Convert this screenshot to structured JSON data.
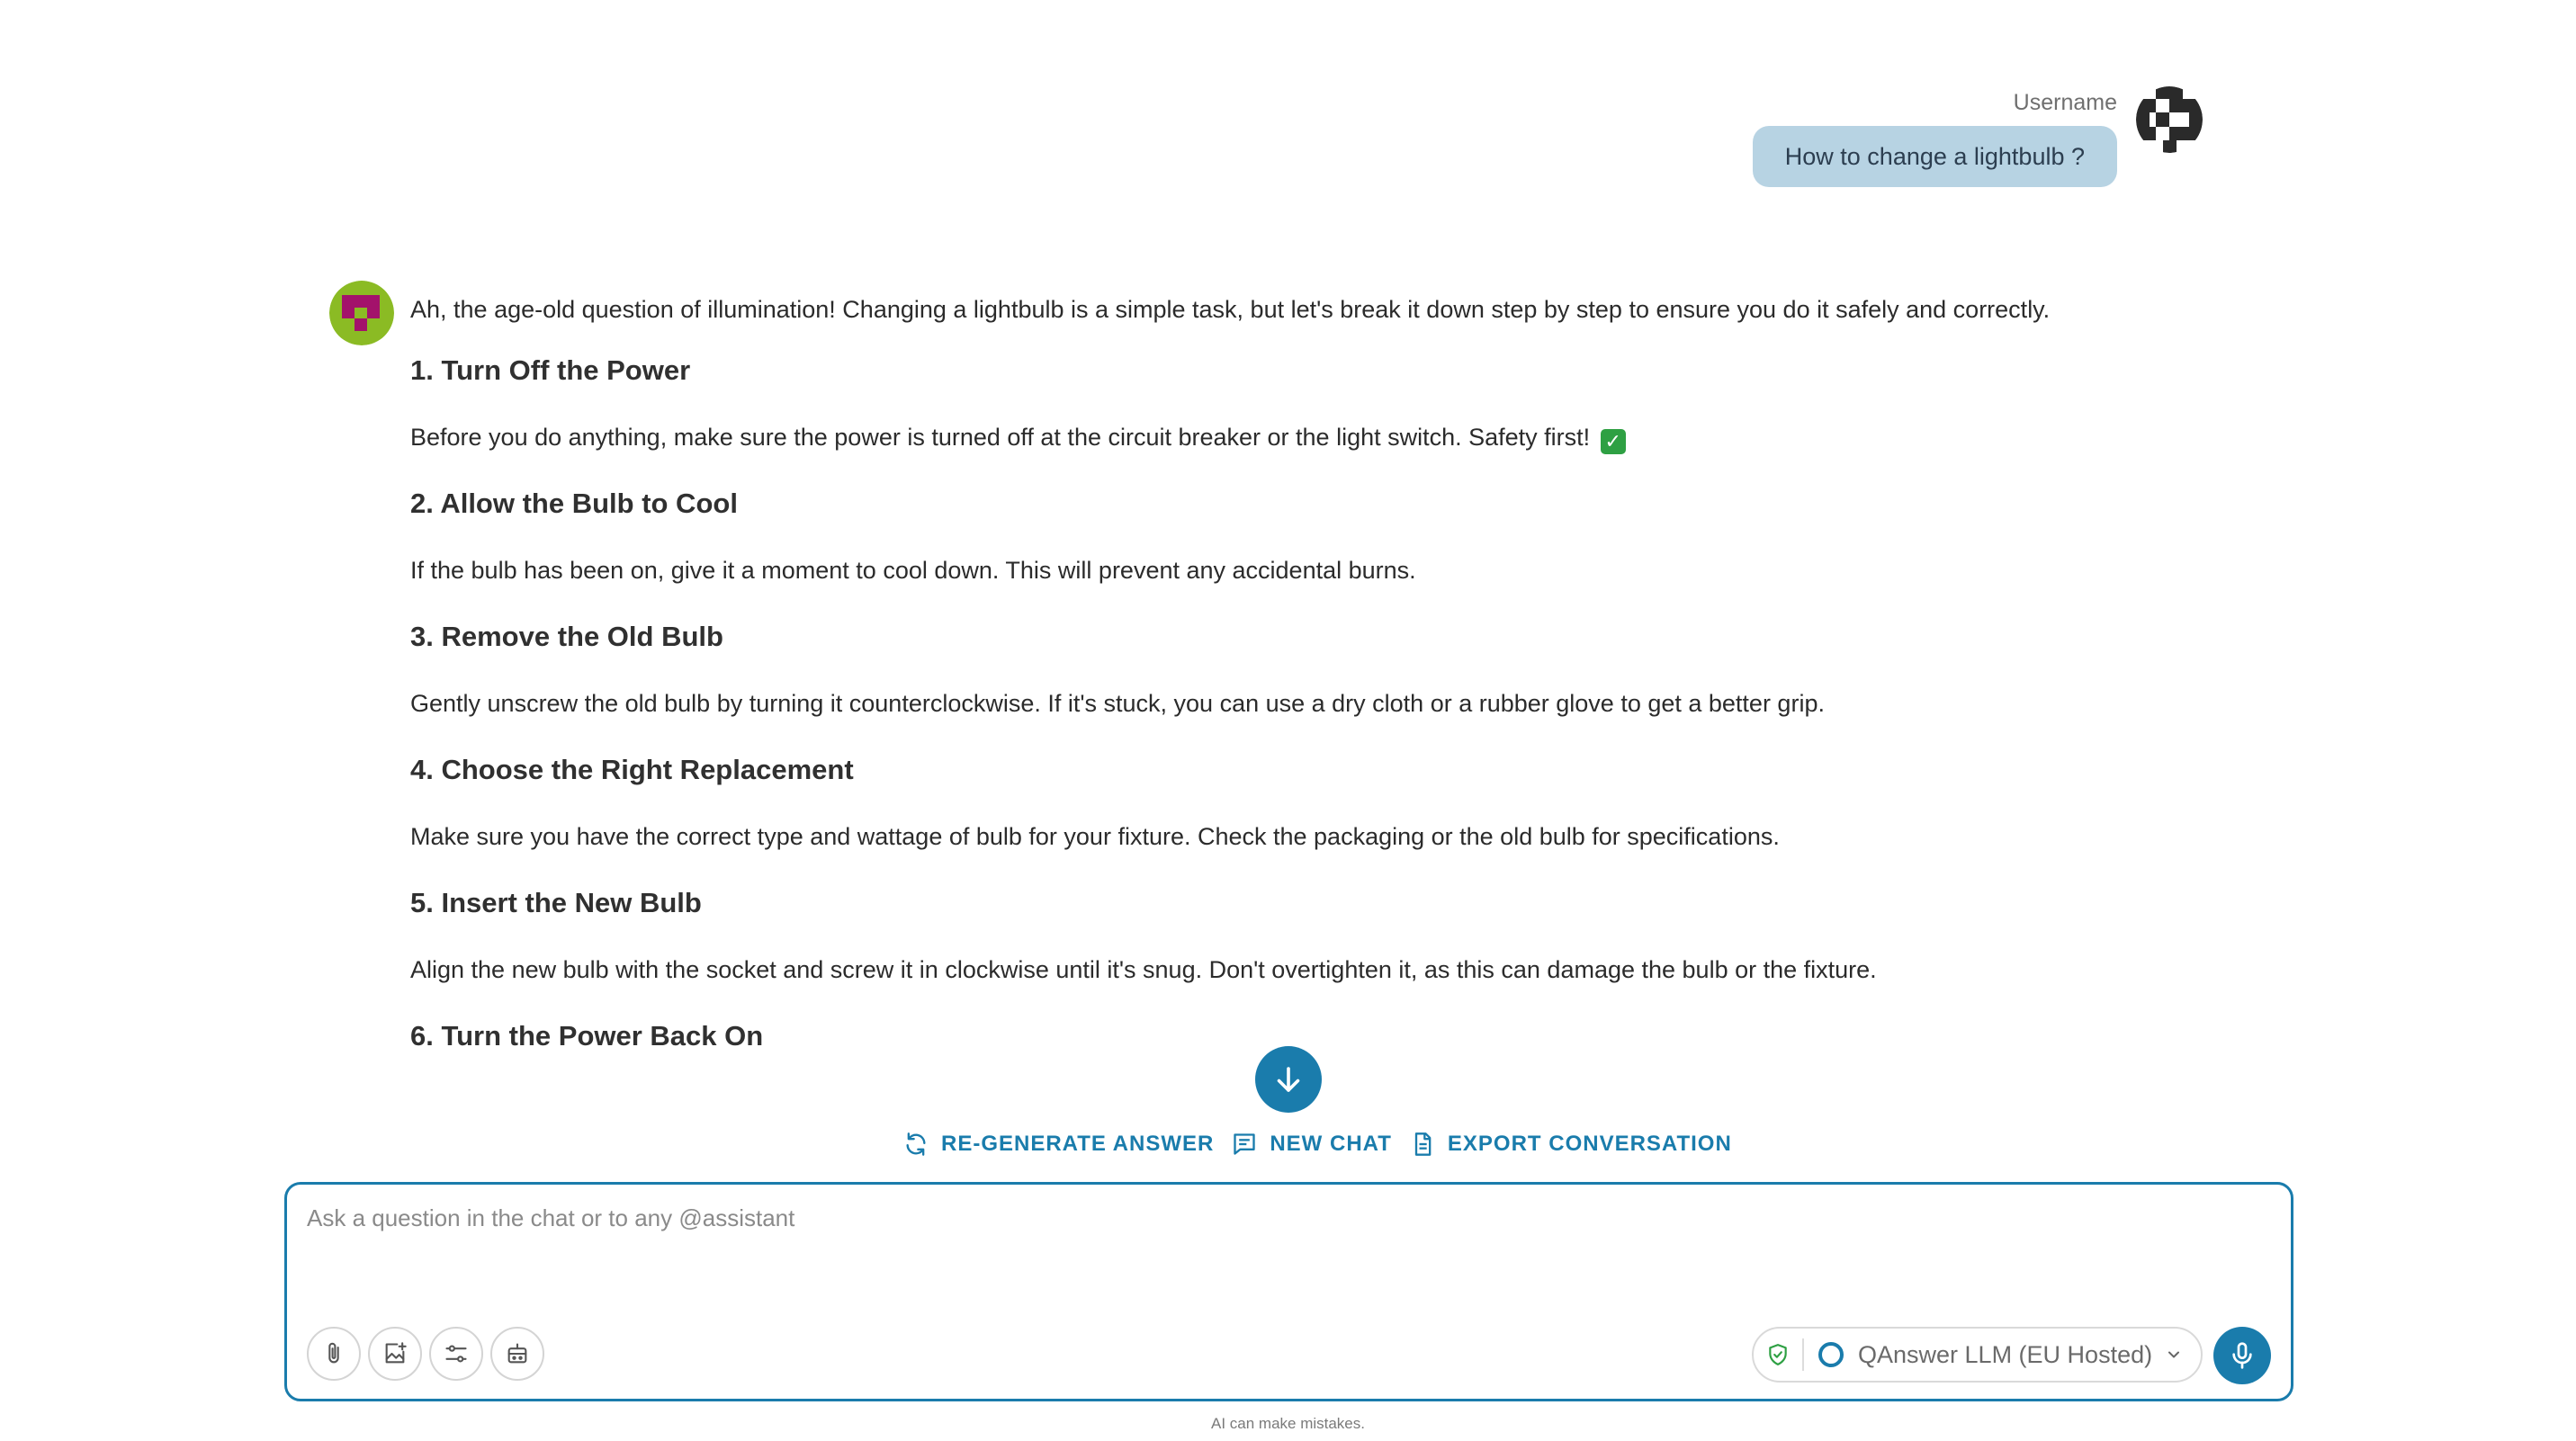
{
  "user": {
    "name": "Username",
    "message": "How to change a lightbulb ?"
  },
  "answer": {
    "intro": "Ah, the age-old question of illumination! Changing a lightbulb is a simple task, but let's break it down step by step to ensure you do it safely and correctly.",
    "steps": [
      {
        "title": "1. Turn Off the Power",
        "text": "Before you do anything, make sure the power is turned off at the circuit breaker or the light switch. Safety first!"
      },
      {
        "title": "2. Allow the Bulb to Cool",
        "text": "If the bulb has been on, give it a moment to cool down. This will prevent any accidental burns."
      },
      {
        "title": "3. Remove the Old Bulb",
        "text": "Gently unscrew the old bulb by turning it counterclockwise. If it's stuck, you can use a dry cloth or a rubber glove to get a better grip."
      },
      {
        "title": "4. Choose the Right Replacement",
        "text": "Make sure you have the correct type and wattage of bulb for your fixture. Check the packaging or the old bulb for specifications."
      },
      {
        "title": "5. Insert the New Bulb",
        "text": "Align the new bulb with the socket and screw it in clockwise until it's snug. Don't overtighten it, as this can damage the bulb or the fixture."
      },
      {
        "title": "6. Turn the Power Back On"
      }
    ],
    "check_glyph": "✓"
  },
  "actions": {
    "regenerate": "RE-GENERATE ANSWER",
    "new_chat": "NEW CHAT",
    "export": "EXPORT CONVERSATION"
  },
  "composer": {
    "placeholder": "Ask a question in the chat or to any @assistant",
    "value": "",
    "model": "QAnswer LLM (EU Hosted)"
  },
  "icons": {
    "attach": "paperclip-icon",
    "image": "image-add-icon",
    "settings": "sliders-icon",
    "assistant": "robot-icon",
    "shield": "shield-check-icon",
    "model": "circle-logo-icon",
    "mic": "microphone-icon"
  },
  "colors": {
    "accent": "#1a7cac",
    "user_bubble": "#b7d3e3",
    "bot_avatar_green": "#8bbb24",
    "bot_avatar_magenta": "#a3126b",
    "check": "#2ea043"
  },
  "footer": {
    "disclaimer": "AI can make mistakes."
  }
}
